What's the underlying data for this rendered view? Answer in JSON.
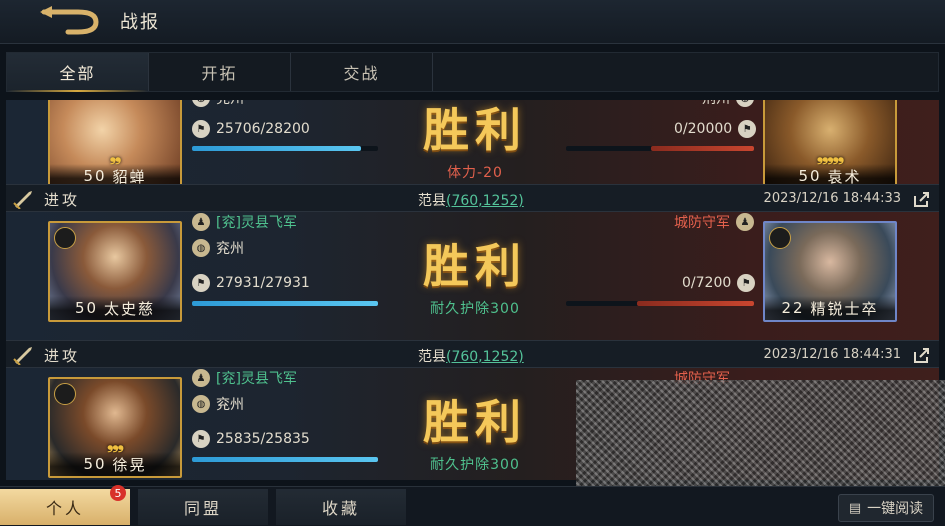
{
  "header": {
    "title": "战报"
  },
  "tabs": [
    {
      "label": "全部",
      "active": true
    },
    {
      "label": "开拓",
      "active": false
    },
    {
      "label": "交战",
      "active": false
    }
  ],
  "reports": [
    {
      "partial": true,
      "left": {
        "level": "50",
        "name": "貂蝉",
        "stars": "❟❟",
        "place": "兖州",
        "troops": "25706/28200",
        "hp_fraction": 0.91
      },
      "right": {
        "level": "50",
        "name": "袁术",
        "stars": "❟❟❟❟❟",
        "place": "荆州",
        "troops": "0/20000",
        "hp_fraction": 0.0
      },
      "result": "胜利",
      "note": "体力-20",
      "note_color": "red"
    },
    {
      "action": "进攻",
      "location": "范县",
      "coords": "(760,1252)",
      "time": "2023/12/16 18:44:33",
      "left": {
        "level": "50",
        "name": "太史慈",
        "place": "兖州",
        "team": "[兖]灵县飞军",
        "troops": "27931/27931",
        "hp_fraction": 1.0
      },
      "right": {
        "level": "22",
        "name": "精锐士卒",
        "defender": "城防守军",
        "troops": "0/7200",
        "hp_fraction": 0.0
      },
      "result": "胜利",
      "note": "耐久护除300",
      "note_color": "green"
    },
    {
      "action": "进攻",
      "location": "范县",
      "coords": "(760,1252)",
      "time": "2023/12/16 18:44:31",
      "left": {
        "level": "50",
        "name": "徐晃",
        "stars": "❟❟❟",
        "place": "兖州",
        "team": "[兖]灵县飞军",
        "troops": "25835/25835",
        "hp_fraction": 1.0
      },
      "right": {
        "defender": "城防守军"
      },
      "result": "胜利",
      "note": "耐久护除300",
      "note_color": "green"
    }
  ],
  "bottom_tabs": [
    {
      "label": "个人",
      "active": true,
      "badge": "5"
    },
    {
      "label": "同盟",
      "active": false
    },
    {
      "label": "收藏",
      "active": false
    }
  ],
  "read_all_label": "一键阅读",
  "colors": {
    "accent_gold": "#d6a940",
    "team_green": "#4fc18e",
    "enemy_red": "#e2604c",
    "hp_blue": "#2d9ad6"
  }
}
